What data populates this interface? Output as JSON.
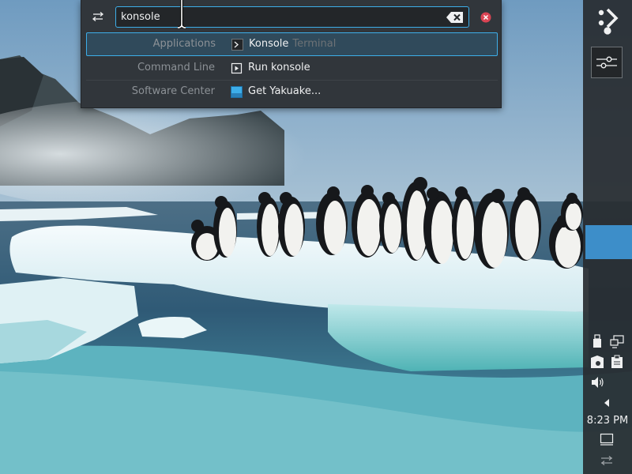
{
  "krunner": {
    "query": "konsole",
    "results": [
      {
        "category": "Applications",
        "title": "Konsole",
        "subtitle": "Terminal",
        "icon": "terminal-icon",
        "selected": true
      },
      {
        "category": "Command Line",
        "title": "Run konsole",
        "subtitle": "",
        "icon": "run-command-icon",
        "selected": false
      },
      {
        "category": "Software Center",
        "title": "Get Yakuake...",
        "subtitle": "",
        "icon": "software-center-icon",
        "selected": false
      }
    ],
    "icons": {
      "config": "settings-sliders-icon",
      "clear": "backspace-clear-icon",
      "close": "close-circle-icon"
    }
  },
  "panel": {
    "clock": "8:23 PM",
    "icons": [
      "application-launcher-icon",
      "pager-toggle-icon",
      "usb-device-icon",
      "network-icon",
      "vault-icon",
      "clipboard-icon",
      "volume-icon",
      "expand-tray-icon",
      "show-desktop-icon",
      "panel-settings-icon"
    ]
  },
  "colors": {
    "accent": "#3daee9",
    "dialog_bg": "#31363b",
    "field_bg": "#232629",
    "close_red": "#da4453",
    "task_highlight": "#3d8ec9"
  }
}
